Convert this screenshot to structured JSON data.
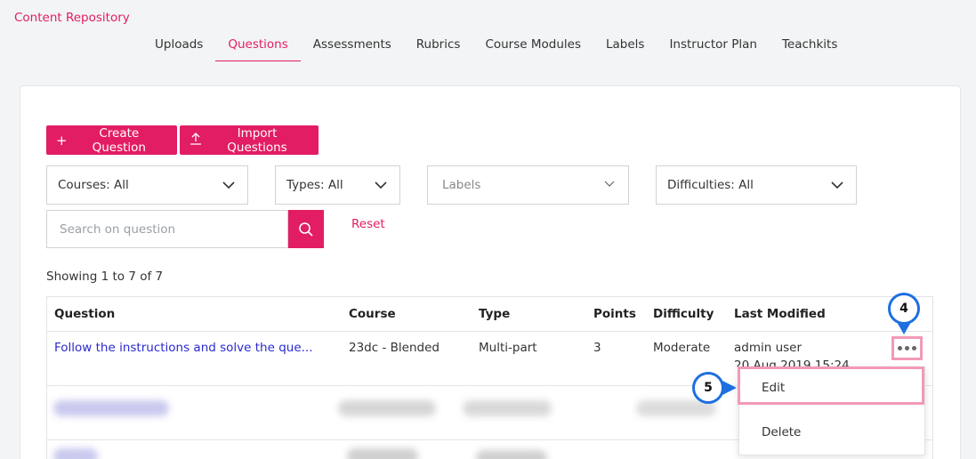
{
  "header": {
    "brand": "Content Repository",
    "tabs": [
      "Uploads",
      "Questions",
      "Assessments",
      "Rubrics",
      "Course Modules",
      "Labels",
      "Instructor Plan",
      "Teachkits"
    ],
    "active_tab": "Questions"
  },
  "toolbar": {
    "create_label": "Create Question",
    "import_label": "Import Questions"
  },
  "filters": {
    "courses": "Courses: All",
    "types": "Types: All",
    "labels_placeholder": "Labels",
    "difficulties": "Difficulties: All",
    "search_placeholder": "Search on question",
    "reset_label": "Reset"
  },
  "summary": "Showing 1 to 7 of 7",
  "table": {
    "columns": [
      "Question",
      "Course",
      "Type",
      "Points",
      "Difficulty",
      "Last Modified"
    ],
    "rows": [
      {
        "question": "Follow the instructions and solve the que...",
        "course": "23dc - Blended",
        "type": "Multi-part",
        "points": "3",
        "difficulty": "Moderate",
        "modified_by": "admin user",
        "modified_date": "20 Aug 2019 15:24"
      }
    ]
  },
  "row_menu": {
    "items": [
      "Edit",
      "Delete"
    ]
  },
  "callouts": {
    "kebab": "4",
    "edit": "5"
  },
  "colors": {
    "accent": "#e21d63",
    "highlight": "#f29ab6",
    "callout_ring": "#1e6fe0",
    "link": "#2a2acf"
  }
}
